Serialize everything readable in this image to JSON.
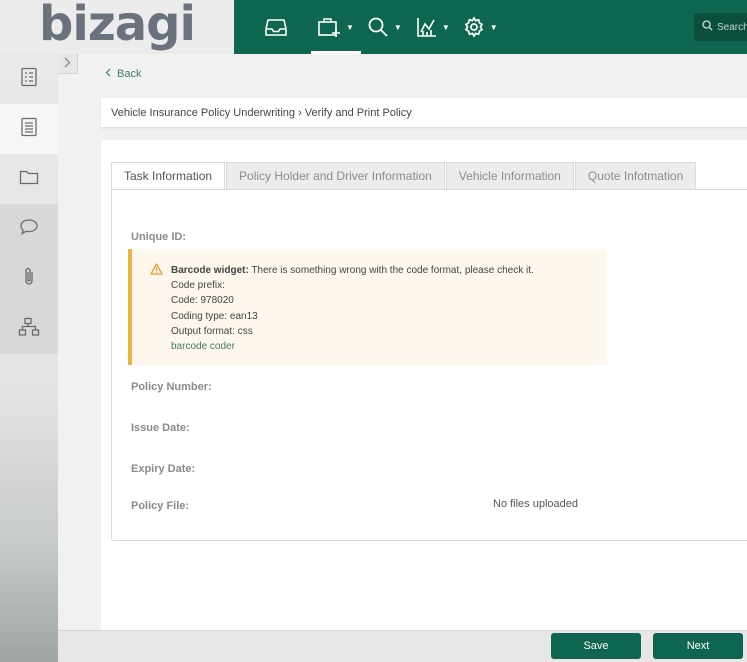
{
  "logo": "bizagi",
  "header": {
    "nav": [
      {
        "icon": "inbox-icon",
        "has_dropdown": false
      },
      {
        "icon": "new-case-icon",
        "has_dropdown": true,
        "active": true
      },
      {
        "icon": "search-icon",
        "has_dropdown": true
      },
      {
        "icon": "analytics-icon",
        "has_dropdown": true
      },
      {
        "icon": "gear-icon",
        "has_dropdown": true
      }
    ],
    "search_placeholder": "Search"
  },
  "sidebar": {
    "items": [
      {
        "icon": "form-icon"
      },
      {
        "icon": "document-icon",
        "active": true
      },
      {
        "icon": "folder-icon"
      },
      {
        "icon": "comment-icon"
      },
      {
        "icon": "attachment-icon"
      },
      {
        "icon": "workflow-icon"
      }
    ]
  },
  "back_label": "Back",
  "breadcrumb": "Vehicle Insurance Policy Underwriting › Verify and Print Policy",
  "tabs": [
    {
      "label": "Task Information",
      "active": true
    },
    {
      "label": "Policy Holder and Driver Information"
    },
    {
      "label": "Vehicle Information"
    },
    {
      "label": "Quote Infotmation"
    }
  ],
  "fields": {
    "unique_id": "Unique ID:",
    "policy_number": "Policy Number:",
    "issue_date": "Issue Date:",
    "expiry_date": "Expiry Date:",
    "policy_file": "Policy File:"
  },
  "warning": {
    "title": "Barcode widget:",
    "message": " There is something wrong with the code format, please check it.",
    "lines": [
      "Code prefix:",
      "Code: 978020",
      "Coding type: ean13",
      "Output format: css"
    ],
    "link": "barcode coder"
  },
  "no_files": "No files uploaded",
  "buttons": {
    "save": "Save",
    "next": "Next"
  },
  "colors": {
    "brand": "#0f6650",
    "warning_accent": "#f2b33d",
    "link": "#3f7d6d"
  }
}
